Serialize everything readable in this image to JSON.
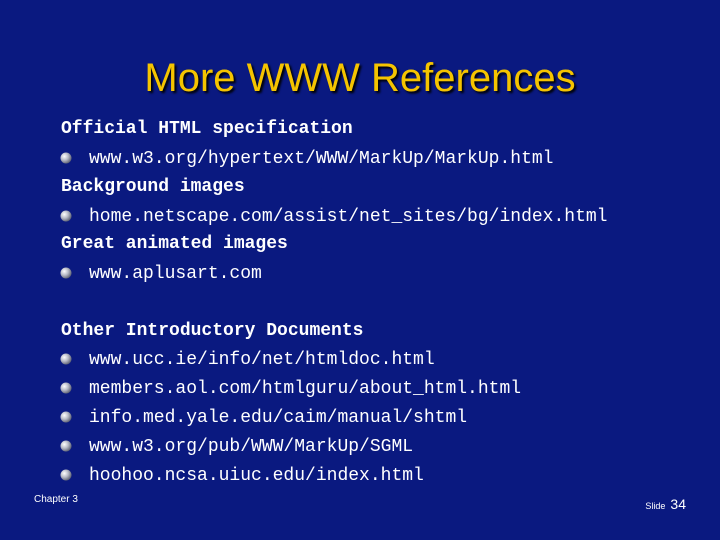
{
  "slide": {
    "title": "More WWW References",
    "sections": [
      {
        "heading": "Official HTML specification",
        "items": [
          "www.w3.org/hypertext/WWW/MarkUp/MarkUp.html"
        ]
      },
      {
        "heading": "Background images",
        "items": [
          "home.netscape.com/assist/net_sites/bg/index.html"
        ]
      },
      {
        "heading": "Great animated images",
        "items": [
          "www.aplusart.com"
        ]
      },
      {
        "heading": "Other Introductory Documents",
        "items": [
          "www.ucc.ie/info/net/htmldoc.html",
          "members.aol.com/htmlguru/about_html.html",
          "info.med.yale.edu/caim/manual/shtml",
          "www.w3.org/pub/WWW/MarkUp/SGML",
          "hoohoo.ncsa.uiuc.edu/index.html"
        ]
      }
    ]
  },
  "footer": {
    "chapter": "Chapter 3",
    "slide_label": "Slide",
    "slide_number": "34"
  },
  "colors": {
    "background": "#0a1980",
    "title": "#f5c400",
    "text": "#ffffff"
  },
  "icons": {
    "bullet": "sphere-bullet-icon"
  }
}
